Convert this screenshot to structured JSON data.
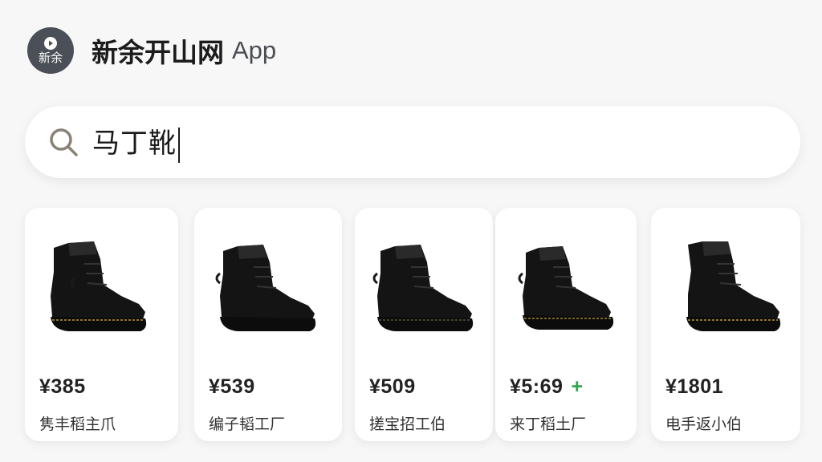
{
  "header": {
    "logo_text": "新余",
    "title": "新余开山网",
    "suffix": "App"
  },
  "search": {
    "query": "马丁靴",
    "icon": "search-icon"
  },
  "products": [
    {
      "price": "¥385",
      "name": "隽丰稻主爪",
      "badge": ""
    },
    {
      "price": "¥539",
      "name": "编子韬工厂",
      "badge": ""
    },
    {
      "price": "¥509",
      "name": "搓宝招工伯",
      "badge": ""
    },
    {
      "price": "¥5:69",
      "name": "来丁稻土厂",
      "badge": "+"
    },
    {
      "price": "¥1801",
      "name": "电手返小伯",
      "badge": ""
    }
  ],
  "colors": {
    "logo_bg": "#4b4f57",
    "plus": "#2ea84a",
    "boot": "#141414",
    "stitch": "#b49a3a"
  }
}
